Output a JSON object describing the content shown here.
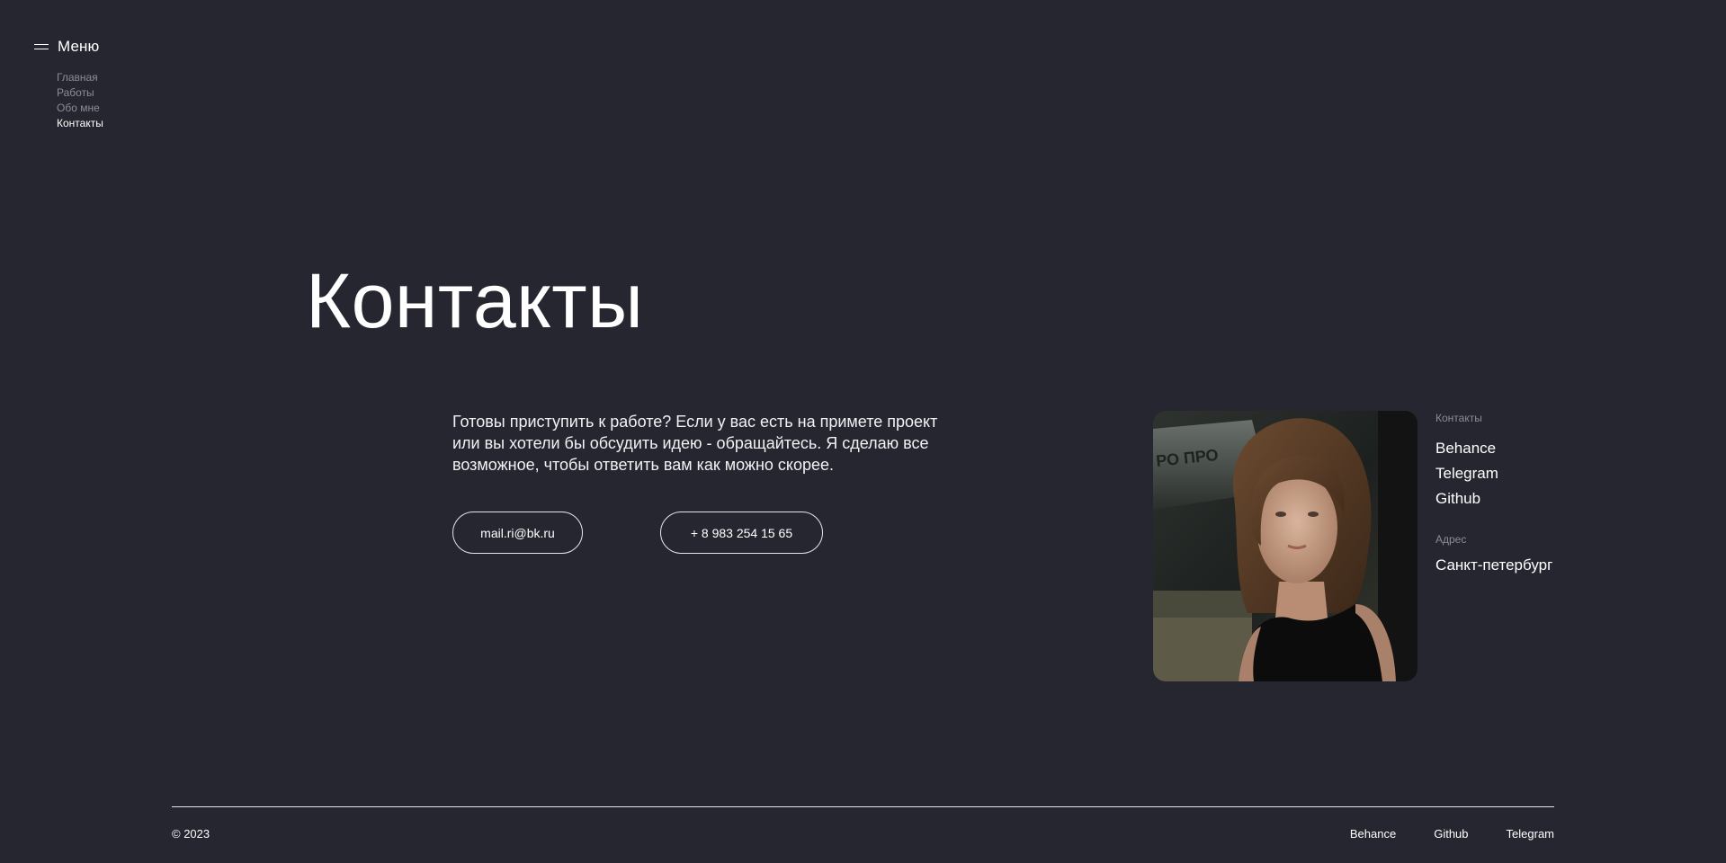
{
  "menu": {
    "title": "Меню",
    "items": [
      {
        "label": "Главная"
      },
      {
        "label": "Работы"
      },
      {
        "label": "Обо мне"
      },
      {
        "label": "Контакты"
      }
    ]
  },
  "main": {
    "title": "Контакты",
    "intro": "Готовы приступить к работе? Если у вас есть на примете проект или вы хотели бы обсудить идею - обращайтесь. Я сделаю все возможное, чтобы ответить вам как можно скорее.",
    "email": "mail.ri@bk.ru",
    "phone": "+ 8 983 254 15 65"
  },
  "sidebar": {
    "contacts_label": "Контакты",
    "links": [
      {
        "label": "Behance"
      },
      {
        "label": "Telegram"
      },
      {
        "label": "Github"
      }
    ],
    "address_label": "Адрес",
    "city": "Санкт-петербург"
  },
  "footer": {
    "copyright": "© 2023",
    "links": [
      {
        "label": "Behance"
      },
      {
        "label": "Github"
      },
      {
        "label": "Telegram"
      }
    ]
  },
  "colors": {
    "background": "#262630",
    "text": "#ffffff",
    "muted": "#8c8c96"
  }
}
